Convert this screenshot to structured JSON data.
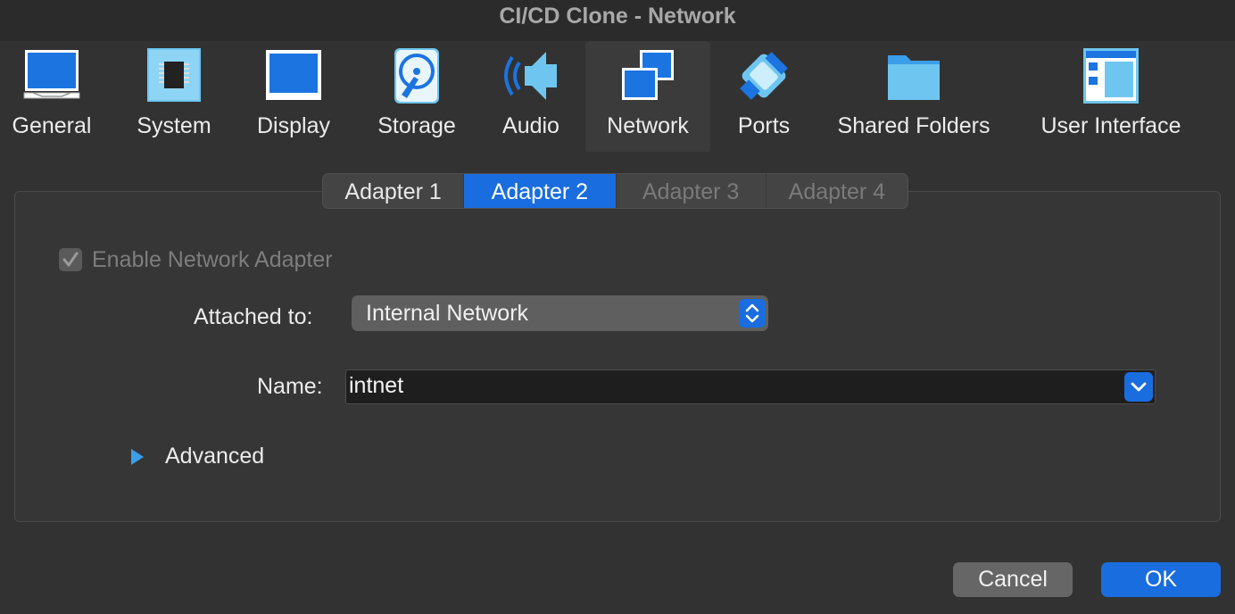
{
  "window": {
    "title": "CI/CD Clone - Network"
  },
  "toolbar": {
    "items": [
      {
        "label": "General",
        "icon": "general-monitor-icon"
      },
      {
        "label": "System",
        "icon": "chip-icon"
      },
      {
        "label": "Display",
        "icon": "display-icon"
      },
      {
        "label": "Storage",
        "icon": "hard-disk-icon"
      },
      {
        "label": "Audio",
        "icon": "speaker-icon"
      },
      {
        "label": "Network",
        "icon": "network-icon",
        "selected": true
      },
      {
        "label": "Ports",
        "icon": "serial-port-icon"
      },
      {
        "label": "Shared Folders",
        "icon": "folder-icon"
      },
      {
        "label": "User Interface",
        "icon": "window-layout-icon"
      }
    ]
  },
  "adapter_tabs": [
    {
      "label": "Adapter 1",
      "state": "normal"
    },
    {
      "label": "Adapter 2",
      "state": "active"
    },
    {
      "label": "Adapter 3",
      "state": "disabled"
    },
    {
      "label": "Adapter 4",
      "state": "disabled"
    }
  ],
  "form": {
    "enable_adapter": {
      "label": "Enable Network Adapter",
      "checked": true,
      "disabled": true
    },
    "attached_to": {
      "label": "Attached to:",
      "value": "Internal Network"
    },
    "name": {
      "label": "Name:",
      "value": "intnet"
    },
    "advanced": {
      "label": "Advanced",
      "expanded": false
    }
  },
  "buttons": {
    "cancel": "Cancel",
    "ok": "OK"
  },
  "colors": {
    "accent": "#1a6dde",
    "background": "#323232",
    "icon_blue": "#2a82e4"
  }
}
